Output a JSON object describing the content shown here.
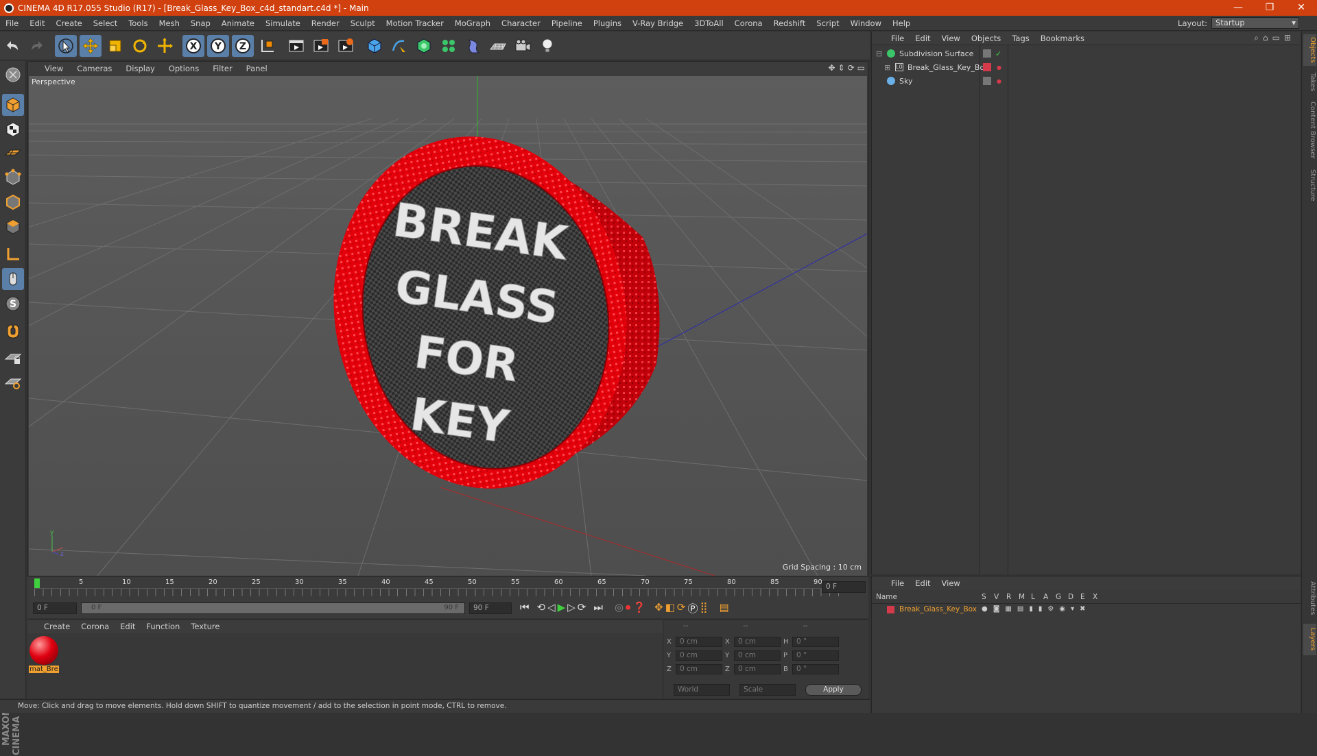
{
  "window": {
    "title": "CINEMA 4D R17.055 Studio (R17) - [Break_Glass_Key_Box_c4d_standart.c4d *] - Main",
    "minimize": "—",
    "maximize": "❐",
    "close": "✕"
  },
  "menu": [
    "File",
    "Edit",
    "Create",
    "Select",
    "Tools",
    "Mesh",
    "Snap",
    "Animate",
    "Simulate",
    "Render",
    "Sculpt",
    "Motion Tracker",
    "MoGraph",
    "Character",
    "Pipeline",
    "Plugins",
    "V-Ray Bridge",
    "3DToAll",
    "Corona",
    "Redshift",
    "Script",
    "Window",
    "Help"
  ],
  "layout": {
    "label": "Layout:",
    "value": "Startup"
  },
  "viewport": {
    "menu": [
      "View",
      "Cameras",
      "Display",
      "Options",
      "Filter",
      "Panel"
    ],
    "label": "Perspective",
    "grid_spacing": "Grid Spacing : 10 cm",
    "sign_lines": [
      "BREAK",
      "GLASS",
      "FOR",
      "KEY"
    ]
  },
  "timeline": {
    "ticks": [
      "0",
      "5",
      "10",
      "15",
      "20",
      "25",
      "30",
      "35",
      "40",
      "45",
      "50",
      "55",
      "60",
      "65",
      "70",
      "75",
      "80",
      "85",
      "90"
    ],
    "current": "0 F"
  },
  "transport": {
    "start": "0 F",
    "range_start": "0 F",
    "range_end": "90 F",
    "end": "90 F"
  },
  "material_manager": {
    "menu": [
      "Create",
      "Corona",
      "Edit",
      "Function",
      "Texture"
    ],
    "material_name": "mat_Bre"
  },
  "coordinates": {
    "headers": [
      "--",
      "--",
      "--"
    ],
    "rows": [
      {
        "axis": "X",
        "pos": "0 cm",
        "saxis": "X",
        "size": "0 cm",
        "raxis": "H",
        "rot": "0 °"
      },
      {
        "axis": "Y",
        "pos": "0 cm",
        "saxis": "Y",
        "size": "0 cm",
        "raxis": "P",
        "rot": "0 °"
      },
      {
        "axis": "Z",
        "pos": "0 cm",
        "saxis": "Z",
        "size": "0 cm",
        "raxis": "B",
        "rot": "0 °"
      }
    ],
    "mode1": "World",
    "mode2": "Scale",
    "apply": "Apply"
  },
  "status": "Move: Click and drag to move elements. Hold down SHIFT to quantize movement / add to the selection in point mode, CTRL to remove.",
  "objects": {
    "menu": [
      "File",
      "Edit",
      "View",
      "Objects",
      "Tags",
      "Bookmarks"
    ],
    "items": [
      {
        "name": "Subdivision Surface"
      },
      {
        "name": "Break_Glass_Key_Box"
      },
      {
        "name": "Sky"
      }
    ]
  },
  "layers": {
    "menu": [
      "File",
      "Edit",
      "View"
    ],
    "name_header": "Name",
    "cols": [
      "S",
      "V",
      "R",
      "M",
      "L",
      "A",
      "G",
      "D",
      "E",
      "X"
    ],
    "layer": "Break_Glass_Key_Box"
  },
  "right_tabs": [
    "Objects",
    "Takes",
    "Content Browser",
    "Structure",
    "Attributes",
    "Layers"
  ],
  "logo": "MAXON CINEMA 4D",
  "colors": {
    "accent": "#d1410f",
    "sign_red": "#e5000a",
    "highlight": "#f0a030"
  }
}
